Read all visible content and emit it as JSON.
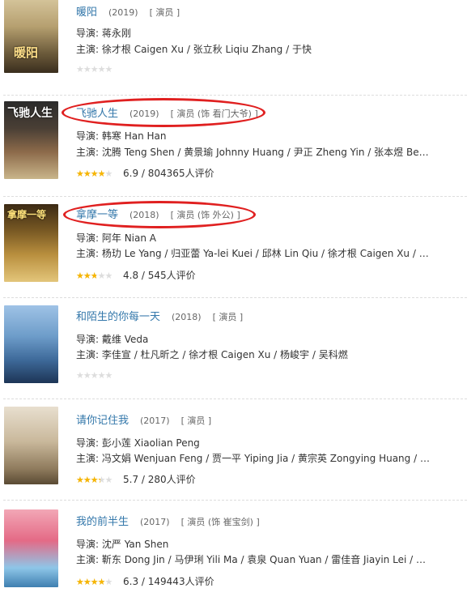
{
  "labels": {
    "director": "导演:",
    "cast": "主演:"
  },
  "colors": {
    "link": "#3377aa",
    "star": "#f7b500",
    "highlight": "#e02020"
  },
  "movies": [
    {
      "poster_text": "暖阳",
      "title": "暖阳",
      "year": "(2019)",
      "role": "[ 演员 ]",
      "director": "蒋永刚",
      "cast": "徐才根 Caigen Xu / 张立秋 Liqiu Zhang / 于快",
      "rating": "",
      "votes": "",
      "stars_fraction": 0
    },
    {
      "poster_text": "飞驰人生",
      "title": "飞驰人生",
      "year": "(2019)",
      "role": "[ 演员 (饰 看门大爷) ]",
      "director": "韩寒 Han Han",
      "cast": "沈腾 Teng Shen / 黄景瑜 Johnny Huang / 尹正 Zheng Yin / 张本煜 Benyu Zha...",
      "rating": "6.9",
      "votes": "804365人评价",
      "stars_fraction": 0.7
    },
    {
      "poster_text": "拿摩一等",
      "title": "拿摩一等",
      "year": "(2018)",
      "role": "[ 演员 (饰 外公) ]",
      "director": "阿年 Nian A",
      "cast": "杨玏 Le Yang / 归亚蕾 Ya-lei Kuei / 邱林 Lin Qiu / 徐才根 Caigen Xu / 陶...",
      "rating": "4.8",
      "votes": "545人评价",
      "stars_fraction": 0.5
    },
    {
      "poster_text": "",
      "title": "和陌生的你每一天",
      "year": "(2018)",
      "role": "[ 演员 ]",
      "director": "戴维 Veda",
      "cast": "李佳宣 / 杜凡昕之 / 徐才根 Caigen Xu / 杨峻宇 / 吴科燃",
      "rating": "",
      "votes": "",
      "stars_fraction": 0
    },
    {
      "poster_text": "",
      "title": "请你记住我",
      "year": "(2017)",
      "role": "[ 演员 ]",
      "director": "彭小莲 Xiaolian Peng",
      "cast": "主演: 冯文娟 Wenjuan Feng / 贾一平 Yiping Jia / 黄宗英 Zongying Huang / 徐才根...",
      "rating": "5.7",
      "votes": "280人评价",
      "stars_fraction": 0.6
    },
    {
      "poster_text": "",
      "title": "我的前半生",
      "year": "(2017)",
      "role": "[ 演员 (饰 崔宝剑) ]",
      "director": "沈严 Yan Shen",
      "cast": "靳东 Dong Jin / 马伊琍 Yili Ma / 袁泉 Quan Yuan / 雷佳音 Jiayin Lei / 吴...",
      "rating": "6.3",
      "votes": "149443人评价",
      "stars_fraction": 0.7
    }
  ]
}
